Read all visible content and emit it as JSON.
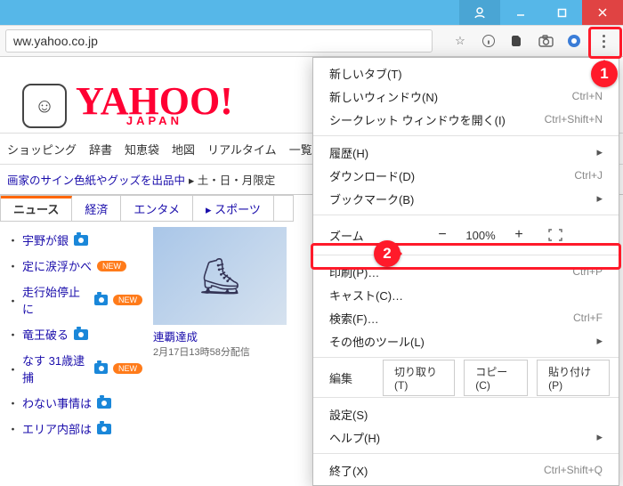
{
  "window": {
    "url": "ww.yahoo.co.jp"
  },
  "page": {
    "logo_main": "YAHOO!",
    "logo_sub": "JAPAN",
    "services": [
      "ショッピング",
      "辞書",
      "知恵袋",
      "地図",
      "リアルタイム"
    ],
    "service_more": "一覧 ▾",
    "banner_left": "画家のサイン色紙やグッズを出品中",
    "banner_right": "▸ 土・日・月限定",
    "tabs": [
      "ニュース",
      "経済",
      "エンタメ",
      "スポーツ"
    ],
    "news": [
      {
        "t": "宇野が銀",
        "cam": true,
        "new": false
      },
      {
        "t": "定に涙浮かべ",
        "cam": false,
        "new": true
      },
      {
        "t": "走行始停止に",
        "cam": true,
        "new": true
      },
      {
        "t": "竜王破る",
        "cam": true,
        "new": false
      },
      {
        "t": "なす 31歳逮捕",
        "cam": true,
        "new": true
      },
      {
        "t": "わない事情は",
        "cam": true,
        "new": false
      },
      {
        "t": "エリア内部は",
        "cam": true,
        "new": false
      }
    ],
    "thumb_caption": "連覇達成",
    "thumb_sub": "2月17日13時58分配信"
  },
  "menu": {
    "items1": [
      {
        "label": "新しいタブ(T)",
        "shortcut": ""
      },
      {
        "label": "新しいウィンドウ(N)",
        "shortcut": "Ctrl+N"
      },
      {
        "label": "シークレット ウィンドウを開く(I)",
        "shortcut": "Ctrl+Shift+N"
      }
    ],
    "items2": [
      {
        "label": "履歴(H)",
        "sub": true
      },
      {
        "label": "ダウンロード(D)",
        "shortcut": "Ctrl+J"
      },
      {
        "label": "ブックマーク(B)",
        "sub": true
      }
    ],
    "zoom_label": "ズーム",
    "zoom_value": "100%",
    "items3": [
      {
        "label": "印刷(P)…",
        "shortcut": "Ctrl+P"
      },
      {
        "label": "キャスト(C)…"
      },
      {
        "label": "検索(F)…",
        "shortcut": "Ctrl+F"
      },
      {
        "label": "その他のツール(L)",
        "sub": true
      }
    ],
    "edit_label": "編集",
    "edit_btns": [
      "切り取り(T)",
      "コピー(C)",
      "貼り付け(P)"
    ],
    "items4": [
      {
        "label": "設定(S)"
      },
      {
        "label": "ヘルプ(H)",
        "sub": true
      }
    ],
    "items5": [
      {
        "label": "終了(X)",
        "shortcut": "Ctrl+Shift+Q"
      }
    ]
  },
  "annot": {
    "b1": "1",
    "b2": "2"
  }
}
